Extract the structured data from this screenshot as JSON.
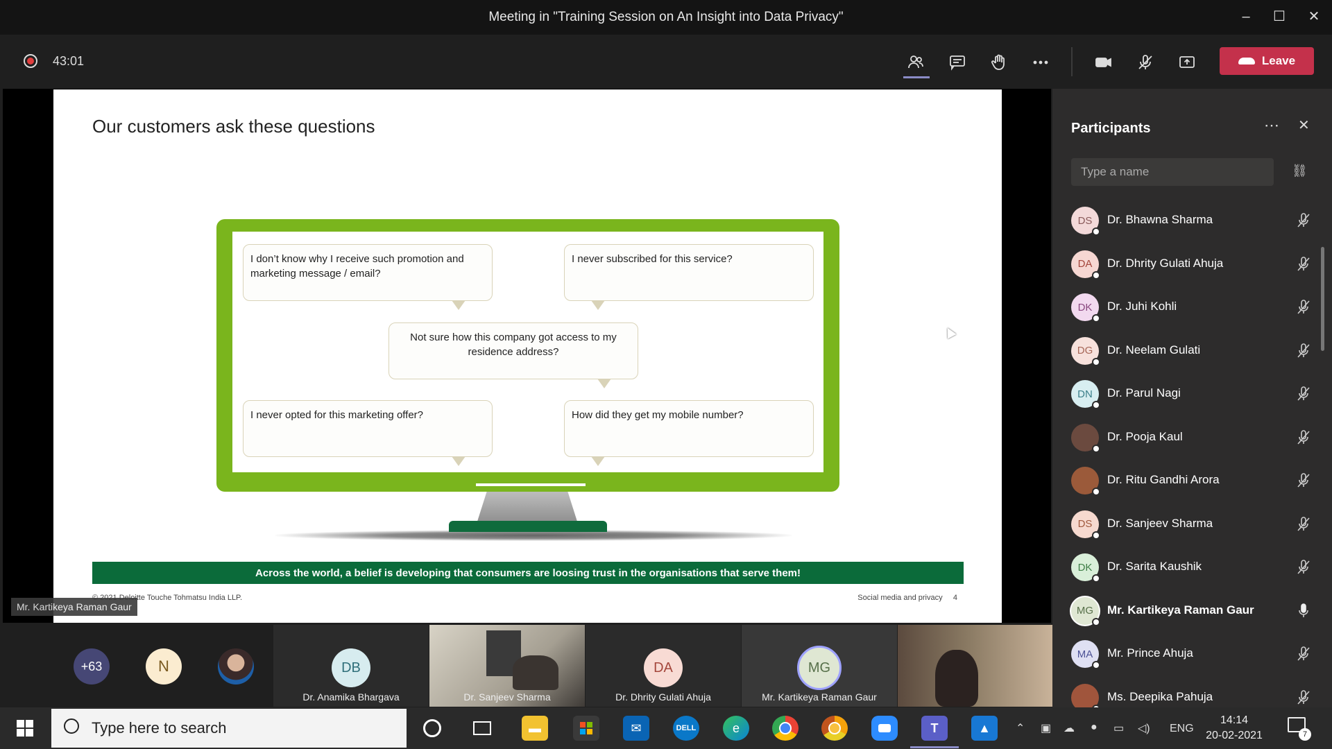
{
  "window": {
    "title": "Meeting in \"Training Session on An Insight into Data Privacy\"",
    "minimize": "–",
    "maximize": "☐",
    "close": "✕"
  },
  "meeting": {
    "timer": "43:01",
    "leave_label": "Leave",
    "toolbar_icons": [
      "participants-icon",
      "chat-icon",
      "raise-hand-icon",
      "more-icon",
      "camera-icon",
      "mic-off-icon",
      "share-icon",
      "phone-icon"
    ]
  },
  "slide": {
    "title": "Our customers ask these questions",
    "bubbles": [
      "I don’t know why I receive such promotion and marketing message / email?",
      "I never subscribed for this service?",
      "Not sure how this company got access to my residence address?",
      "I never opted for this marketing offer?",
      "How did they get my mobile number?"
    ],
    "banner": "Across the world, a belief is developing that consumers are loosing trust in the organisations that serve them!",
    "footer_left": "© 2021 Deloitte Touche Tohmatsu India LLP.",
    "footer_right": "Social media and privacy",
    "page_number": "4",
    "colors": {
      "monitor_green": "#7ab51d",
      "banner_green": "#0b6b3a"
    }
  },
  "presenter_label": "Mr. Kartikeya Raman Gaur",
  "gallery": {
    "overflow_count": "+63",
    "n_initial": "N",
    "tiles": [
      {
        "initials": "DB",
        "name": "Dr. Anamika Bhargava"
      },
      {
        "initials": "",
        "name": "Dr. Sanjeev Sharma"
      },
      {
        "initials": "DA",
        "name": "Dr. Dhrity Gulati Ahuja"
      },
      {
        "initials": "MG",
        "name": "Mr. Kartikeya Raman Gaur"
      },
      {
        "initials": "",
        "name": ""
      }
    ]
  },
  "participants": {
    "title": "Participants",
    "search_placeholder": "Type a name",
    "list": [
      {
        "initials": "DS",
        "name": "Dr. Bhawna Sharma",
        "color": "#f3d9d9",
        "text": "#8a5a5a",
        "mic": "off"
      },
      {
        "initials": "DA",
        "name": "Dr. Dhrity Gulati Ahuja",
        "color": "#f6d7d2",
        "text": "#a4473c",
        "mic": "off"
      },
      {
        "initials": "DK",
        "name": "Dr. Juhi Kohli",
        "color": "#f2d9ef",
        "text": "#8a4780",
        "mic": "off"
      },
      {
        "initials": "DG",
        "name": "Dr. Neelam Gulati",
        "color": "#f7e1dc",
        "text": "#a76757",
        "mic": "off"
      },
      {
        "initials": "DN",
        "name": "Dr. Parul Nagi",
        "color": "#d8eef1",
        "text": "#3c7f8a",
        "mic": "off"
      },
      {
        "initials": "",
        "name": "Dr. Pooja Kaul",
        "color": "#6b4a3f",
        "text": "#fff",
        "mic": "off"
      },
      {
        "initials": "",
        "name": "Dr. Ritu Gandhi Arora",
        "color": "#9b5a3a",
        "text": "#fff",
        "mic": "off"
      },
      {
        "initials": "DS",
        "name": "Dr. Sanjeev Sharma",
        "color": "#f6d9cf",
        "text": "#a15a3e",
        "mic": "off"
      },
      {
        "initials": "DK",
        "name": "Dr. Sarita Kaushik",
        "color": "#d9efd9",
        "text": "#3f7f47",
        "mic": "off"
      },
      {
        "initials": "MG",
        "name": "Mr. Kartikeya Raman Gaur",
        "color": "#dfe7d3",
        "text": "#57704a",
        "mic": "on"
      },
      {
        "initials": "MA",
        "name": "Mr. Prince Ahuja",
        "color": "#dfe0f3",
        "text": "#4d5296",
        "mic": "off"
      },
      {
        "initials": "",
        "name": "Ms. Deepika Pahuja",
        "color": "#a0553c",
        "text": "#fff",
        "mic": "off"
      }
    ]
  },
  "taskbar": {
    "search_placeholder": "Type here to search",
    "language": "ENG",
    "time": "14:14",
    "date": "20-02-2021",
    "notifications": "7",
    "apps": [
      "windows-icon",
      "cortana-icon",
      "task-view-icon",
      "file-explorer-icon",
      "store-icon",
      "mail-icon",
      "dell-icon",
      "edge-icon",
      "chrome-icon",
      "chrome-canary-icon",
      "zoom-icon",
      "teams-icon",
      "photos-icon"
    ]
  }
}
